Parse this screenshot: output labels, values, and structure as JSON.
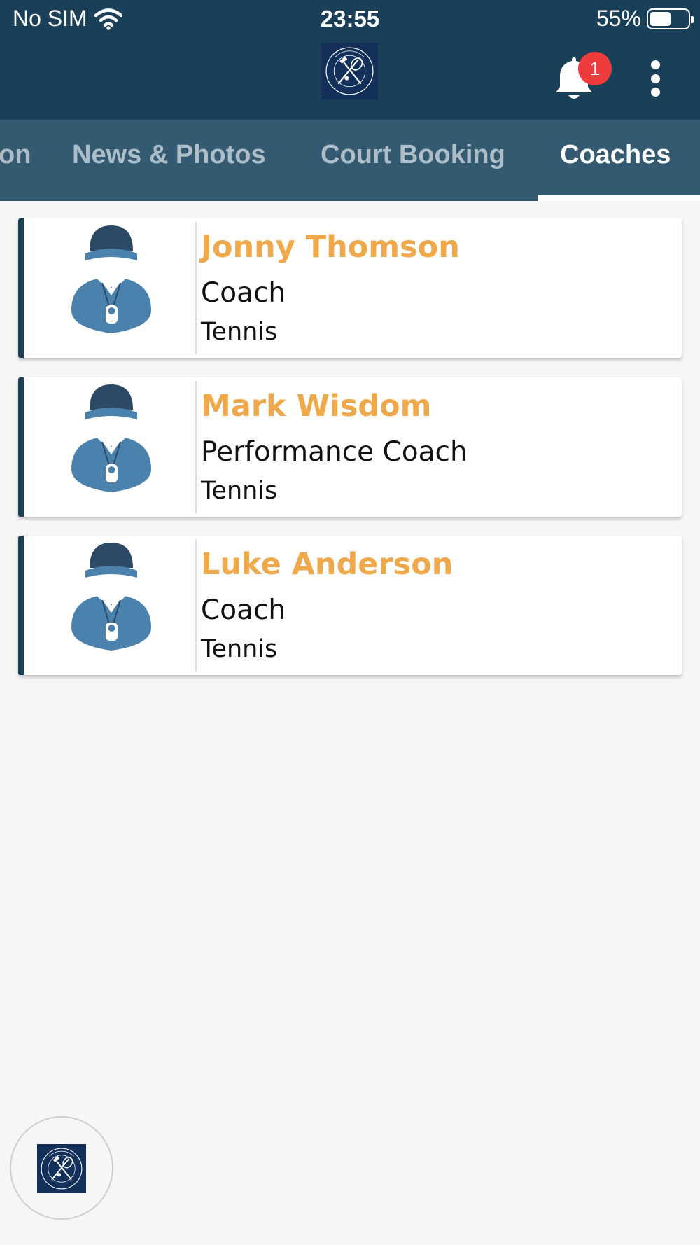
{
  "status_bar": {
    "carrier": "No SIM",
    "time": "23:55",
    "battery": "55%",
    "battery_level": 0.55
  },
  "header": {
    "logo_icon": "woking-club-logo-icon",
    "notifications_count": "1"
  },
  "tabs": [
    {
      "label": "on",
      "active": false
    },
    {
      "label": "News & Photos",
      "active": false
    },
    {
      "label": "Court Booking",
      "active": false
    },
    {
      "label": "Coaches",
      "active": true
    }
  ],
  "coaches": [
    {
      "name": "Jonny Thomson",
      "role": "Coach",
      "sport": "Tennis"
    },
    {
      "name": "Mark Wisdom",
      "role": "Performance Coach",
      "sport": "Tennis"
    },
    {
      "name": "Luke Anderson",
      "role": "Coach",
      "sport": "Tennis"
    }
  ],
  "colors": {
    "header": "#1a4059",
    "tabs": "#335a70",
    "name_accent": "#efa94a",
    "badge": "#ef3b3b",
    "avatar_blue": "#4a82ad",
    "avatar_cap": "#2c4a66"
  }
}
